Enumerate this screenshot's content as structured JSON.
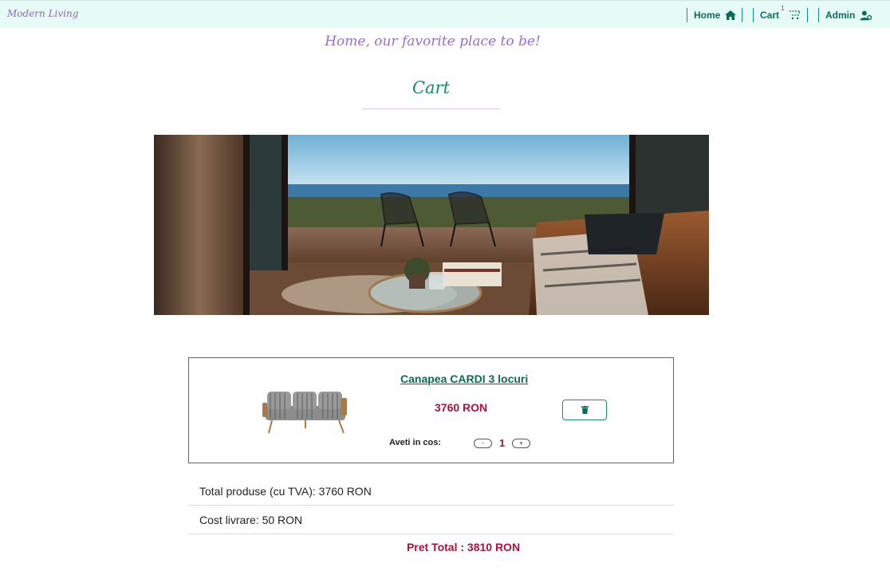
{
  "nav": {
    "brand": "Modern Living",
    "home_label": "Home",
    "cart_label": "Cart",
    "cart_count": "1",
    "admin_label": "Admin",
    "home_icon": "home-icon",
    "cart_icon": "cart-icon",
    "admin_icon": "user-settings-icon"
  },
  "tagline": "Home, our favorite place to be!",
  "page_title": "Cart",
  "cart": {
    "items": [
      {
        "name": "Canapea CARDI 3 locuri",
        "price": "3760 RON",
        "qty_label": "Aveti in cos:",
        "qty": "1",
        "minus": "-",
        "plus": "+",
        "delete_icon": "trash-icon"
      }
    ]
  },
  "summary": {
    "products_total": "Total produse (cu TVA): 3760 RON",
    "delivery": "Cost livrare: 50 RON",
    "grand_total": "Pret Total : 3810 RON"
  },
  "colors": {
    "accent": "#0b6b59",
    "price": "#b0103a",
    "nav_bg": "#e6fbf6",
    "script": "#9a6ec8"
  }
}
